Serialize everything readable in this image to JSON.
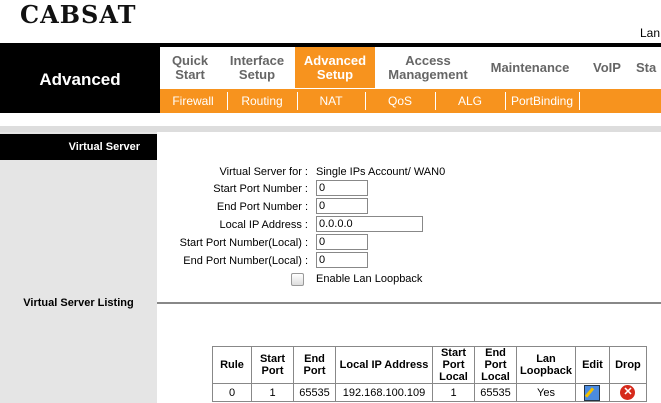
{
  "header": {
    "logo": "CABSAT",
    "lang_fragment": "Lan"
  },
  "section": {
    "title": "Advanced"
  },
  "nav": [
    {
      "label1": "Quick",
      "label2": "Start"
    },
    {
      "label1": "Interface",
      "label2": "Setup"
    },
    {
      "label1": "Advanced",
      "label2": "Setup"
    },
    {
      "label1": "Access",
      "label2": "Management"
    },
    {
      "label1": "Maintenance",
      "label2": ""
    },
    {
      "label1": "VoIP",
      "label2": ""
    },
    {
      "label1": "Sta",
      "label2": ""
    }
  ],
  "subnav": [
    "Firewall",
    "Routing",
    "NAT",
    "QoS",
    "ALG",
    "PortBinding"
  ],
  "left": {
    "tab": "Virtual Server",
    "listing": "Virtual Server Listing"
  },
  "form": {
    "vs_for_label": "Virtual Server for :",
    "vs_for_value": "Single IPs Account/ WAN0",
    "start_port_label": "Start Port Number :",
    "start_port_value": "0",
    "end_port_label": "End Port Number :",
    "end_port_value": "0",
    "local_ip_label": "Local IP Address :",
    "local_ip_value": "0.0.0.0",
    "start_local_label": "Start Port Number(Local) :",
    "start_local_value": "0",
    "end_local_label": "End Port Number(Local) :",
    "end_local_value": "0",
    "loopback_label": "Enable Lan Loopback",
    "loopback_checked": false
  },
  "table": {
    "headers": [
      [
        "Rule"
      ],
      [
        "Start",
        "Port"
      ],
      [
        "End",
        "Port"
      ],
      [
        "Local IP Address"
      ],
      [
        "Start",
        "Port",
        "Local"
      ],
      [
        "End",
        "Port",
        "Local"
      ],
      [
        "Lan",
        "Loopback"
      ],
      [
        "Edit"
      ],
      [
        "Drop"
      ]
    ],
    "rows": [
      {
        "rule": "0",
        "start": "1",
        "end": "65535",
        "ip": "192.168.100.109",
        "start_local": "1",
        "end_local": "65535",
        "loopback": "Yes"
      }
    ]
  }
}
